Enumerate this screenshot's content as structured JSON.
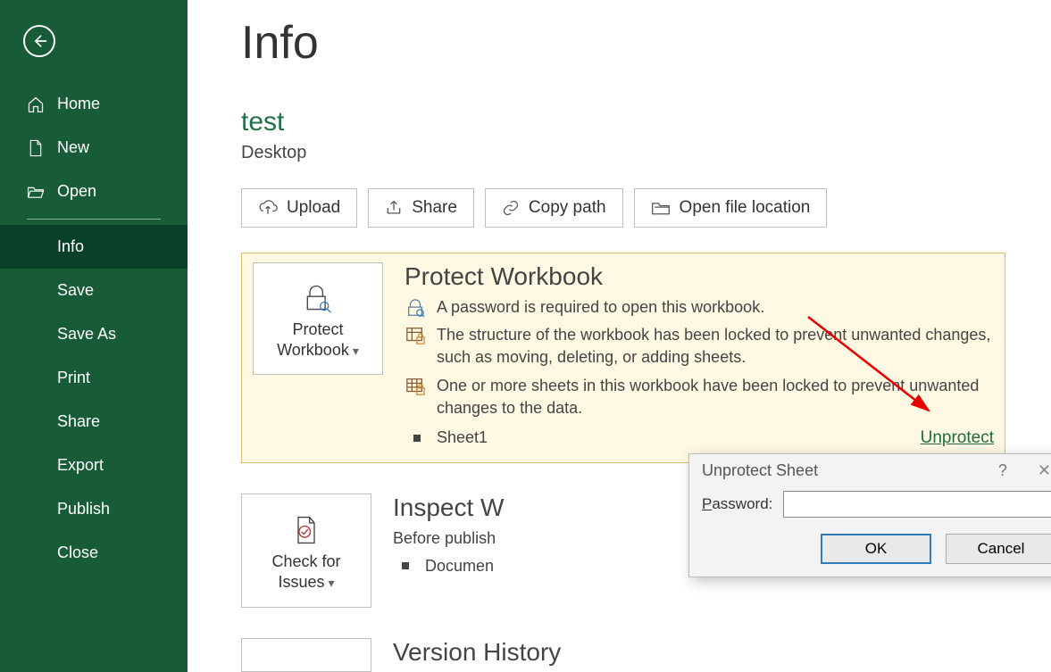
{
  "sidebar": {
    "items": [
      {
        "label": "Home",
        "icon": "home-icon"
      },
      {
        "label": "New",
        "icon": "new-icon"
      },
      {
        "label": "Open",
        "icon": "open-icon"
      }
    ],
    "sub": [
      {
        "label": "Info"
      },
      {
        "label": "Save"
      },
      {
        "label": "Save As"
      },
      {
        "label": "Print"
      },
      {
        "label": "Share"
      },
      {
        "label": "Export"
      },
      {
        "label": "Publish"
      },
      {
        "label": "Close"
      }
    ],
    "active": "Info"
  },
  "page": {
    "title": "Info",
    "docName": "test",
    "docLocation": "Desktop"
  },
  "actions": {
    "upload": "Upload",
    "share": "Share",
    "copyPath": "Copy path",
    "openLocation": "Open file location"
  },
  "protect": {
    "btnLine1": "Protect",
    "btnLine2": "Workbook",
    "heading": "Protect Workbook",
    "line1": "A password is required to open this workbook.",
    "line2": "The structure of the workbook has been locked to prevent unwanted changes, such as moving, deleting, or adding sheets.",
    "line3": "One or more sheets in this workbook have been locked to prevent unwanted changes to the data.",
    "sheet": "Sheet1",
    "unprotect": "Unprotect"
  },
  "inspect": {
    "btnLine1": "Check for",
    "btnLine2": "Issues",
    "heading": "Inspect W",
    "sub": "Before publish",
    "bullet1": "Documen"
  },
  "version": {
    "heading": "Version History"
  },
  "dialog": {
    "title": "Unprotect Sheet",
    "passwordLabelPrefix": "P",
    "passwordLabelRest": "assword:",
    "value": "",
    "ok": "OK",
    "cancel": "Cancel"
  }
}
